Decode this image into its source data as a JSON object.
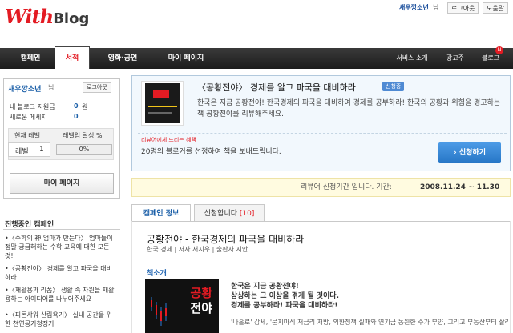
{
  "header": {
    "logo_text_1": "With",
    "logo_text_2": "Blog",
    "user_nickname": "새우깡소년",
    "user_suffix": "님",
    "logout": "로그아웃",
    "help": "도움말"
  },
  "nav": {
    "left": [
      {
        "label": "캠페인"
      },
      {
        "label": "서적"
      },
      {
        "label": "영화·공연"
      },
      {
        "label": "마이 페이지"
      }
    ],
    "right": [
      {
        "label": "서비스 소개"
      },
      {
        "label": "광고주"
      },
      {
        "label": "블로그"
      }
    ],
    "new_badge": "N"
  },
  "sidebar": {
    "nickname": "새우깡소년",
    "nickname_suffix": "님",
    "logout": "로그아웃",
    "blog_support_label": "내 블로그 지원금",
    "blog_support_value": "0",
    "blog_support_unit": "원",
    "new_message_label": "새로운 메세지",
    "new_message_value": "0",
    "current_level_label": "현재 레벨",
    "levelup_label": "레벨업 달성 %",
    "level_prefix": "레벨",
    "level_value": "1",
    "progress_text": "0%",
    "progress": 0,
    "mypage_button": "마이 페이지",
    "ongoing_title": "진행중인 캠페인",
    "campaigns": [
      "•〈수학의 神 엄마가 만든다〉 엄마들이 정말 궁금해하는 수학 교육에 대한 모든 것!",
      "•〈공황전야〉 경제를 알고 파국을 대비하라",
      "•〈재활용과 리폼〉 생활 속 자원을 재활용하는 아이디어를 나누어주세요",
      "•〈피톤샤워 산림욕기〉 실내 공간을 위한 천연공기청정기"
    ]
  },
  "campaign": {
    "title": "〈공황전야〉 경제를 알고 파국을 대비하라",
    "badge": "신청중",
    "description": "한국은 지금 공황전야! 한국경제의 파국을 대비하여 경제를 공부하라! 한국의 공황과 위험을 경고하는 책 공황전야를 리뷰해주세요.",
    "benefit_label": "리뷰어에게 드리는 혜택",
    "benefit_text": "20명의 블로거를 선정하여 책을 보내드립니다.",
    "apply_button": "신청하기",
    "period_label": "리뷰어 신청기간 입니다. 기간:",
    "period_value": "2008.11.24 ~ 11.30"
  },
  "tabs": {
    "info": "캠페인 정보",
    "applied": "신청합니다",
    "applied_count": "[10]"
  },
  "book": {
    "heading": "공황전야 - 한국경제의 파국을 대비하라",
    "meta": "한국 경제 | 저자 서지우 | 출판사 지안",
    "intro_label": "책소개",
    "cover_title_1": "공황",
    "cover_title_2": "전야",
    "intro_line1": "한국은 지금 공황전야!",
    "intro_line2": "상상하는 그 이상을 겪게 될 것이다.",
    "intro_line3": "경제를 공부하라! 파국을 대비하라!",
    "intro_rest": "'나홀로' 감세, '묻지마식 저금리 처방, 외환정책 실패와 연기금 동원한 주가 부양, 그리고 부동산부터 살리고 보겠다는 '막무가내' 정책들... 그리고 단편적으로 우"
  },
  "colors": {
    "brand_red": "#e31b23",
    "nav_dark": "#2a2a2a",
    "link_blue": "#1b5fa8",
    "apply_blue": "#2f80d0"
  }
}
